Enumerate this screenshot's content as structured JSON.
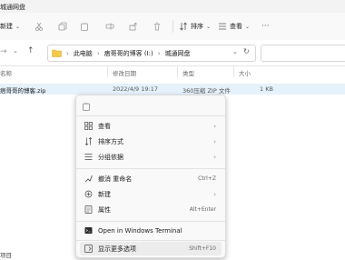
{
  "window": {
    "title": "城通网盘"
  },
  "toolbar": {
    "new_label": "新建",
    "sort_label": "排序",
    "view_label": "查看"
  },
  "breadcrumb": [
    "此电脑",
    "痞哥哥的博客 (I:)",
    "城通网盘"
  ],
  "columns": {
    "name": "名称",
    "modified": "修改日期",
    "type": "类型",
    "size": "大小"
  },
  "files": [
    {
      "name": "痞哥哥的博客.zip",
      "modified": "2022/4/9 19:17",
      "type": "360压缩 ZIP 文件",
      "size": "1 KB"
    }
  ],
  "context_menu": {
    "items": [
      {
        "label": "查看",
        "icon": "grid-view-icon",
        "submenu": true
      },
      {
        "label": "排序方式",
        "icon": "sort-icon",
        "submenu": true
      },
      {
        "label": "分组依据",
        "icon": "group-icon",
        "submenu": true
      },
      {
        "label": "撤消 重命名",
        "icon": "undo-icon",
        "shortcut": "Ctrl+Z"
      },
      {
        "label": "新建",
        "icon": "new-icon",
        "submenu": true
      },
      {
        "label": "属性",
        "icon": "properties-icon",
        "shortcut": "Alt+Enter"
      },
      {
        "label": "Open in Windows Terminal",
        "icon": "terminal-icon"
      },
      {
        "label": "显示更多选项",
        "icon": "more-options-icon",
        "shortcut": "Shift+F10"
      }
    ]
  },
  "status": {
    "text": "项目"
  }
}
